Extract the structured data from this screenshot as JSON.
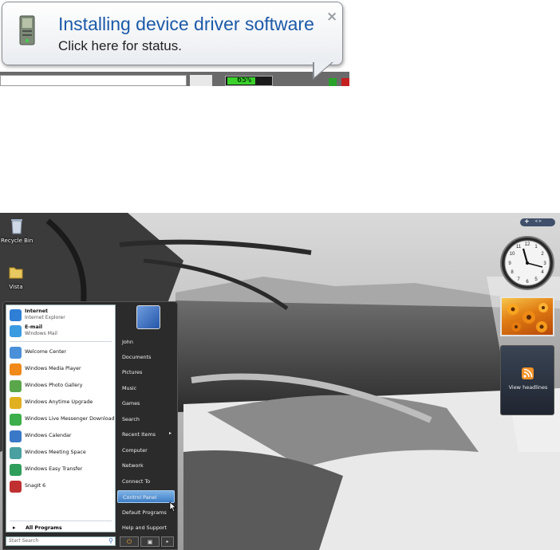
{
  "balloon": {
    "title": "Installing device driver software",
    "text": "Click here for status.",
    "close": "×",
    "icon": "device-driver-icon"
  },
  "taskbar_strip": {
    "meter_text": "65%",
    "meter_value": 0.65
  },
  "desktop": {
    "icons": [
      {
        "label": "Recycle Bin",
        "icon": "recycle-bin-icon"
      },
      {
        "label": "Vista",
        "icon": "folder-icon"
      }
    ]
  },
  "start_menu": {
    "pinned": [
      {
        "name": "Internet",
        "sub": "Internet Explorer",
        "icon": "internet-explorer-icon",
        "color": "#2f7fd6"
      },
      {
        "name": "E-mail",
        "sub": "Windows Mail",
        "icon": "windows-mail-icon",
        "color": "#3a9be0"
      }
    ],
    "recent": [
      {
        "name": "Welcome Center",
        "icon": "welcome-center-icon",
        "color": "#4a90d9"
      },
      {
        "name": "Windows Media Player",
        "icon": "media-player-icon",
        "color": "#f08a1a"
      },
      {
        "name": "Windows Photo Gallery",
        "icon": "photo-gallery-icon",
        "color": "#5aa64a"
      },
      {
        "name": "Windows Anytime Upgrade",
        "icon": "anytime-upgrade-icon",
        "color": "#e0b020"
      },
      {
        "name": "Windows Live Messenger Download",
        "icon": "messenger-icon",
        "color": "#3cae4a"
      },
      {
        "name": "Windows Calendar",
        "icon": "calendar-icon",
        "color": "#3a78c8"
      },
      {
        "name": "Windows Meeting Space",
        "icon": "meeting-space-icon",
        "color": "#4aa0a0"
      },
      {
        "name": "Windows Easy Transfer",
        "icon": "easy-transfer-icon",
        "color": "#2f9e5a"
      },
      {
        "name": "SnagIt 6",
        "icon": "snagit-icon",
        "color": "#c03030"
      }
    ],
    "all_programs": "All Programs",
    "search_placeholder": "Start Search",
    "right": [
      {
        "name": "John"
      },
      {
        "name": "Documents"
      },
      {
        "name": "Pictures"
      },
      {
        "name": "Music"
      },
      {
        "name": "Games"
      },
      {
        "name": "Search"
      },
      {
        "name": "Recent Items",
        "chev": "▸"
      },
      {
        "name": "Computer"
      },
      {
        "name": "Network"
      },
      {
        "name": "Connect To"
      },
      {
        "name": "Control Panel"
      },
      {
        "name": "Default Programs"
      },
      {
        "name": "Help and Support"
      }
    ],
    "active_item": "Control Panel"
  },
  "sidebar": {
    "feed_label": "View headlines",
    "controls_plus": "+",
    "controls_nav": "◂ ▸"
  },
  "colors": {
    "balloon_title": "#1c5aa8",
    "start_active": "#3e7ec6"
  }
}
